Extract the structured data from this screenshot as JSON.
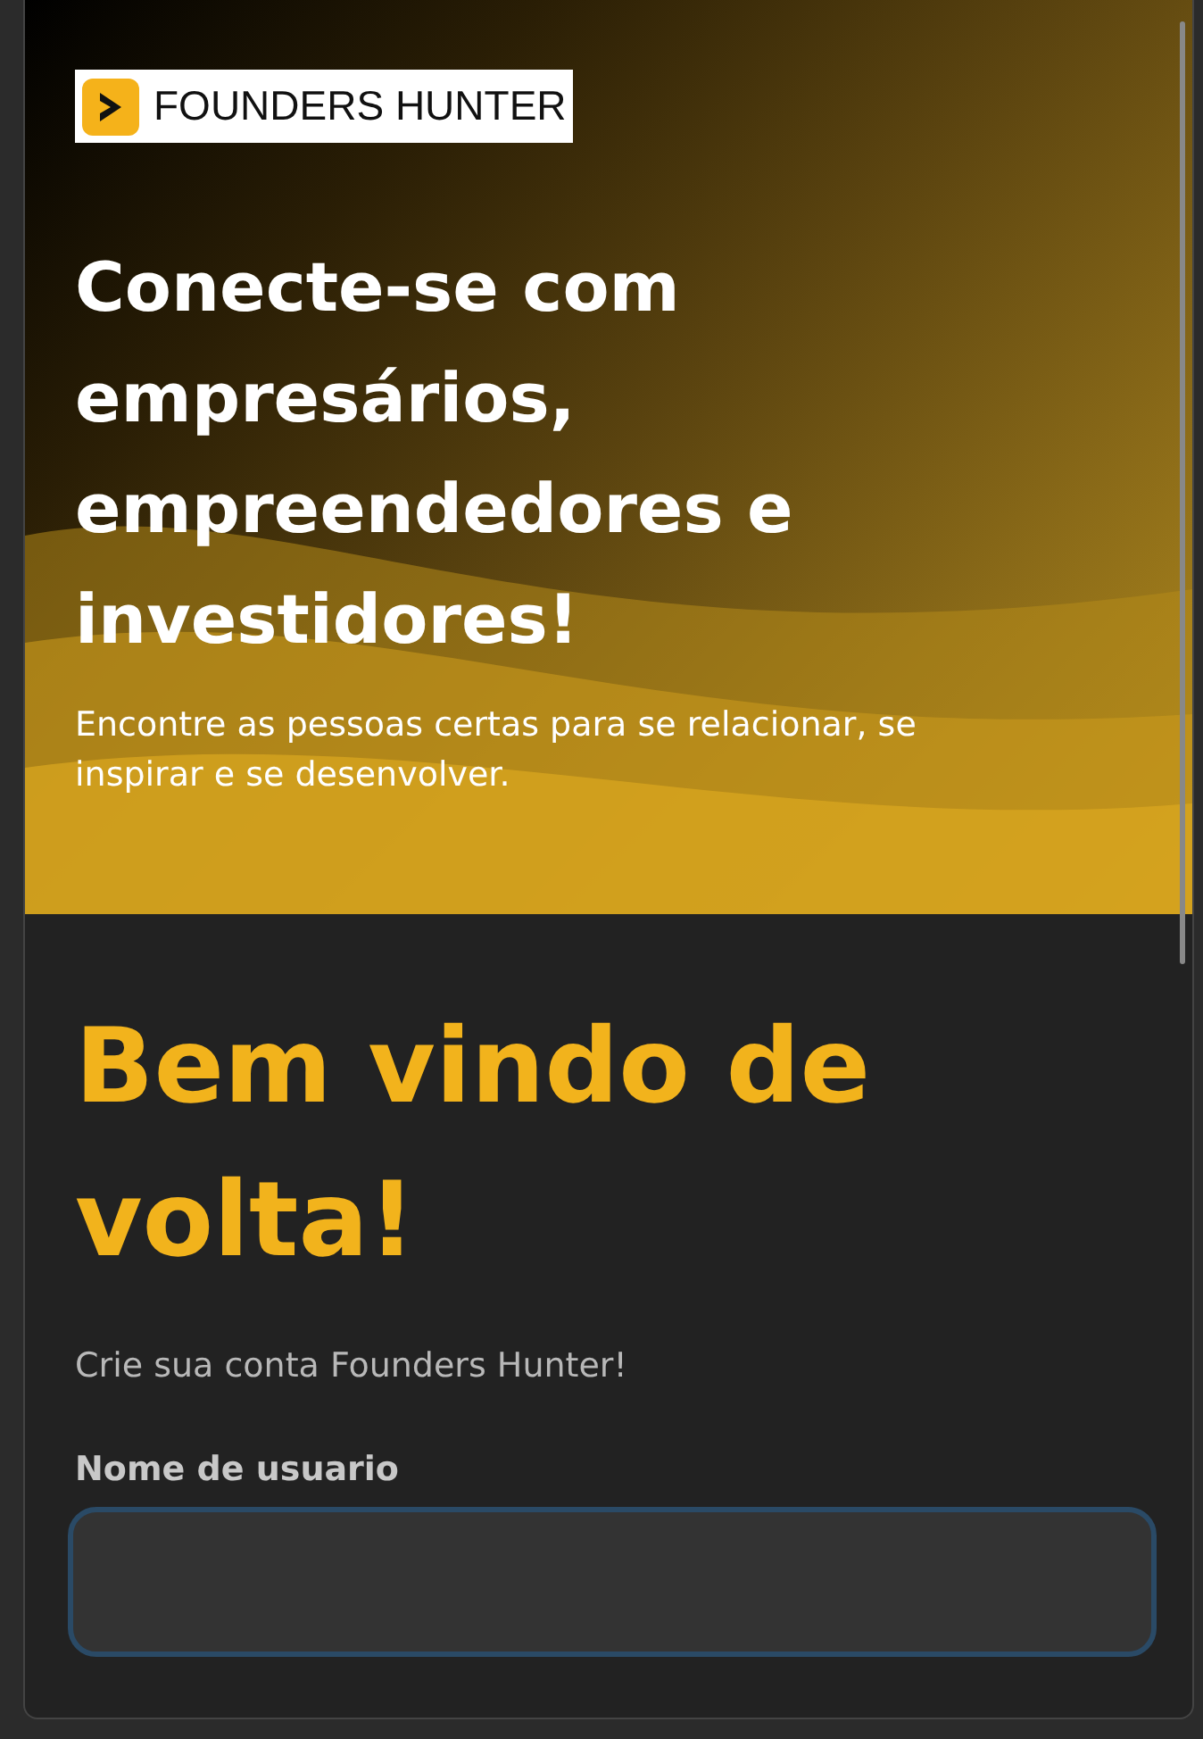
{
  "logo": {
    "text": "FOUNDERS HUNTER"
  },
  "hero": {
    "title": "Conecte-se com empresários, empreendedores e investidores!",
    "subtitle": "Encontre as pessoas certas para se relacionar, se inspirar e se desenvolver."
  },
  "login": {
    "heading": "Bem vindo de volta!",
    "subheading": "Crie sua conta Founders Hunter!",
    "fields": [
      {
        "label": "Nome de usuario"
      }
    ]
  }
}
